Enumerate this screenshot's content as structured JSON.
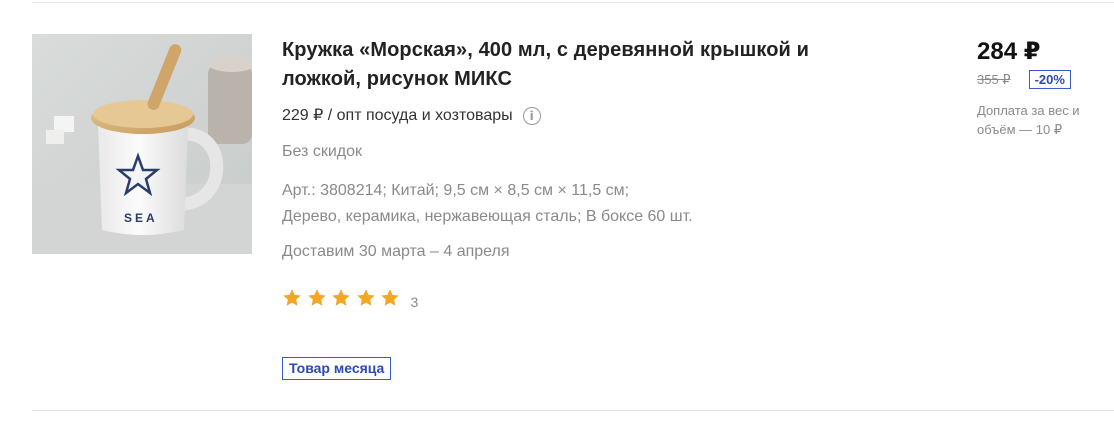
{
  "product": {
    "title": "Кружка «Морская», 400 мл, с деревянной крышкой и ложкой, рисунок МИКС",
    "wholesale": "229 ₽ / опт посуда и хозтовары",
    "info_icon": "info-icon",
    "no_discount": "Без скидок",
    "specs_line1": "Арт.: 3808214; Китай; 9,5 см × 8,5 см × 11,5 см;",
    "specs_line2": "Дерево, керамика, нержавеющая сталь; В боксе 60 шт.",
    "delivery": "Доставим 30 марта – 4 апреля",
    "rating": {
      "stars": 5,
      "reviews": "3",
      "star_color": "#f5a623"
    },
    "badge": "Товар месяца",
    "image_text": "SEA"
  },
  "price": {
    "current": "284 ₽",
    "old": "355 ₽",
    "discount": "-20%",
    "surcharge": "Доплата за вес и объём — 10 ₽"
  },
  "colors": {
    "accent_blue": "#3a5bc4",
    "muted_text": "#8a8a8a"
  }
}
